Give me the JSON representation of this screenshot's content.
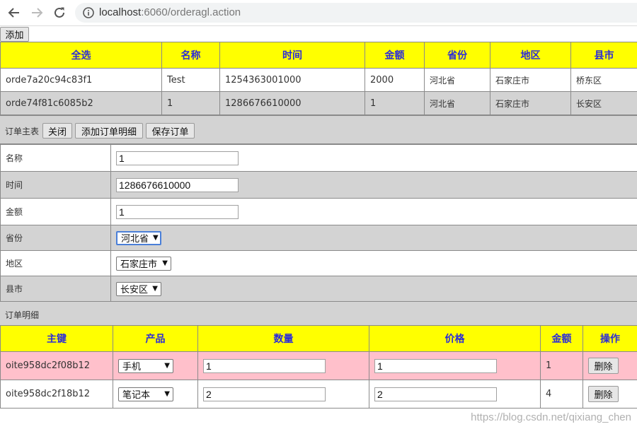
{
  "browser": {
    "url_host": "localhost",
    "url_rest": ":6060/orderagl.action",
    "icons": [
      "back-arrow-icon",
      "forward-arrow-icon",
      "reload-icon",
      "info-icon"
    ]
  },
  "add_label": "添加",
  "order_list": {
    "headers": [
      "全选",
      "名称",
      "时间",
      "金额",
      "省份",
      "地区",
      "县市"
    ],
    "rows": [
      {
        "id": "orde7a20c94c83f1",
        "name": "Test",
        "time": "1254363001000",
        "amount": "2000",
        "province": "河北省",
        "region": "石家庄市",
        "county": "桥东区"
      },
      {
        "id": "orde74f81c6085b2",
        "name": "1",
        "time": "1286676610000",
        "amount": "1",
        "province": "河北省",
        "region": "石家庄市",
        "county": "长安区"
      }
    ]
  },
  "master": {
    "title": "订单主表",
    "close_label": "关闭",
    "add_detail_label": "添加订单明细",
    "save_label": "保存订单",
    "fields": {
      "name_label": "名称",
      "name_value": "1",
      "time_label": "时间",
      "time_value": "1286676610000",
      "amount_label": "金额",
      "amount_value": "1",
      "province_label": "省份",
      "province_value": "河北省",
      "region_label": "地区",
      "region_value": "石家庄市",
      "county_label": "县市",
      "county_value": "长安区"
    }
  },
  "detail": {
    "title": "订单明细",
    "headers": [
      "主键",
      "产品",
      "数量",
      "价格",
      "金额",
      "操作"
    ],
    "rows": [
      {
        "id": "oite958dc2f08b12",
        "product": "手机",
        "qty": "1",
        "price": "1",
        "amount": "1",
        "delete_label": "删除"
      },
      {
        "id": "oite958dc2f18b12",
        "product": "笔记本",
        "qty": "2",
        "price": "2",
        "amount": "4",
        "delete_label": "删除"
      }
    ]
  },
  "colors": {
    "header_bg": "#ffff00",
    "header_text": "#2b2bd9",
    "gray_row": "#d3d3d3",
    "pink_row": "#ffc0cb"
  },
  "watermark": "https://blog.csdn.net/qixiang_chen"
}
